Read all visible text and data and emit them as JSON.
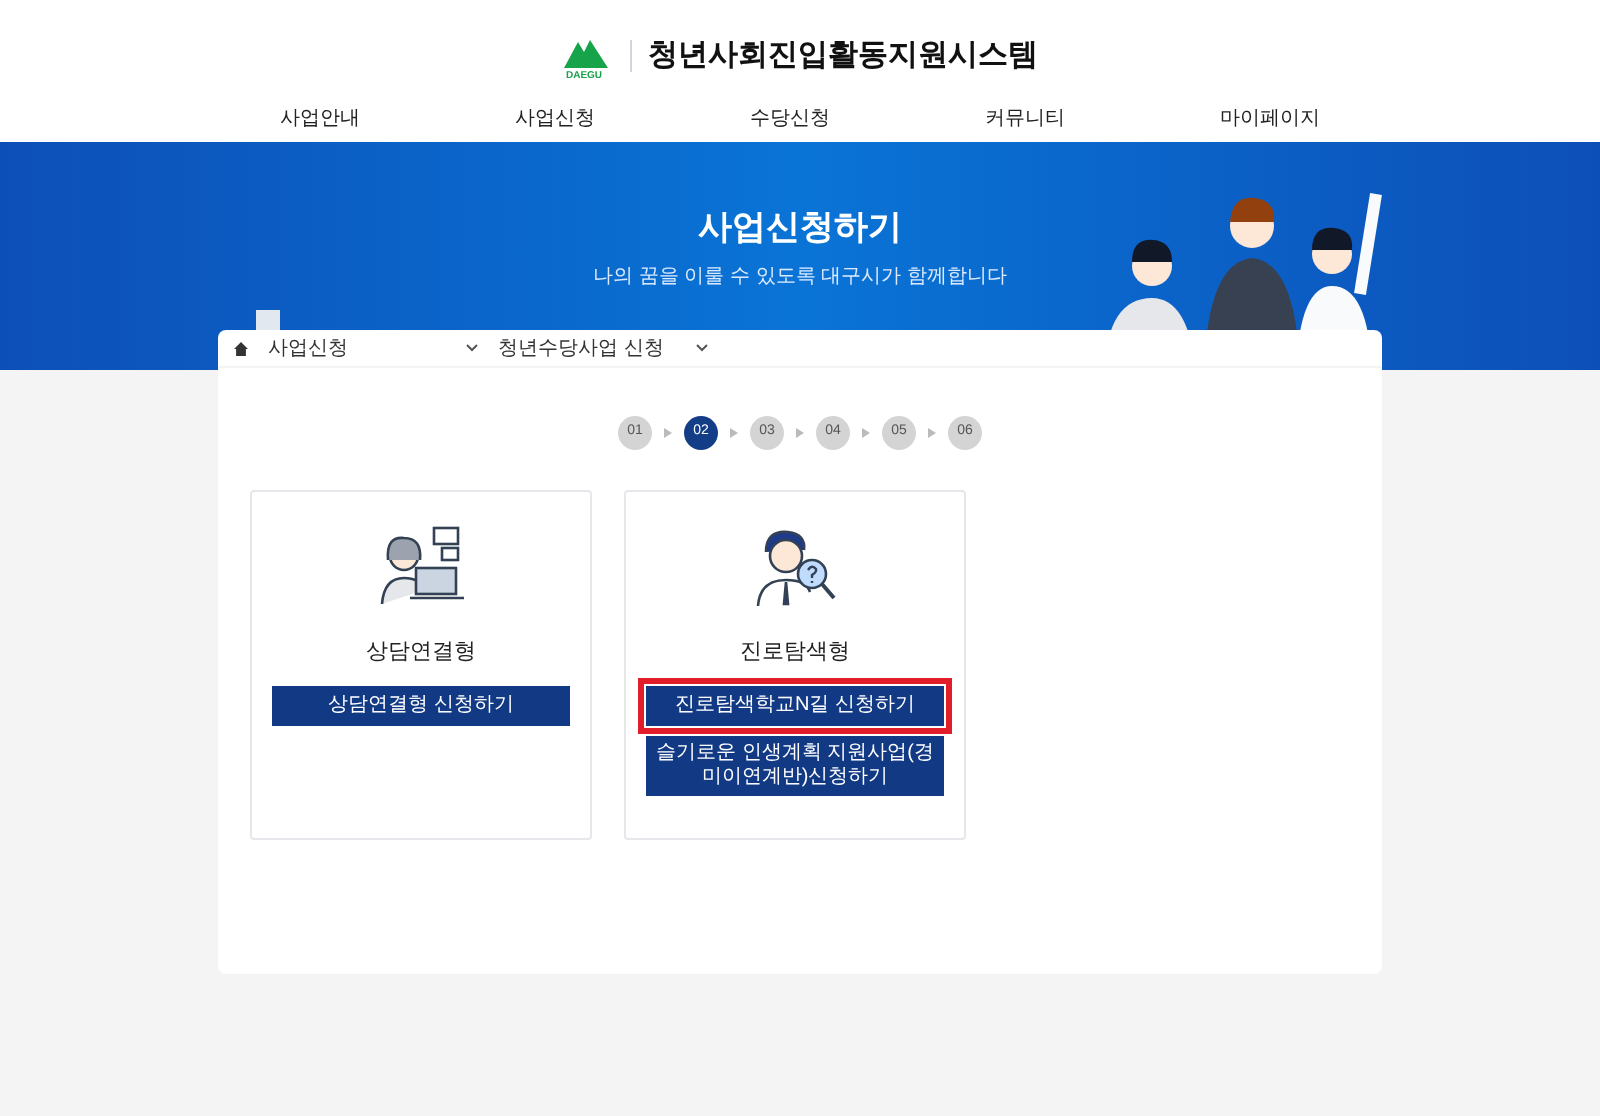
{
  "header": {
    "logo_text": "DAEGU",
    "title": "청년사회진입활동지원시스템"
  },
  "nav": [
    {
      "label": "사업안내"
    },
    {
      "label": "사업신청"
    },
    {
      "label": "수당신청"
    },
    {
      "label": "커뮤니티"
    },
    {
      "label": "마이페이지"
    }
  ],
  "banner": {
    "title": "사업신청하기",
    "subtitle": "나의 꿈을 이룰 수 있도록 대구시가 함께합니다"
  },
  "breadcrumb": [
    {
      "label": "사업신청"
    },
    {
      "label": "청년수당사업 신청"
    }
  ],
  "steps": [
    {
      "label": "01",
      "selected": false
    },
    {
      "label": "02",
      "selected": true
    },
    {
      "label": "03",
      "selected": false
    },
    {
      "label": "04",
      "selected": false
    },
    {
      "label": "05",
      "selected": false
    },
    {
      "label": "06",
      "selected": false
    }
  ],
  "cards": [
    {
      "kind": "counsel",
      "title": "상담연결형",
      "buttons": [
        {
          "label": "상담연결형 신청하기",
          "highlighted": false
        }
      ]
    },
    {
      "kind": "explore",
      "title": "진로탐색형",
      "buttons": [
        {
          "label": "진로탐색학교N길 신청하기",
          "highlighted": true
        },
        {
          "label": "슬기로운 인생계획 지원사업(경미이연계반)신청하기",
          "highlighted": false
        }
      ]
    }
  ]
}
